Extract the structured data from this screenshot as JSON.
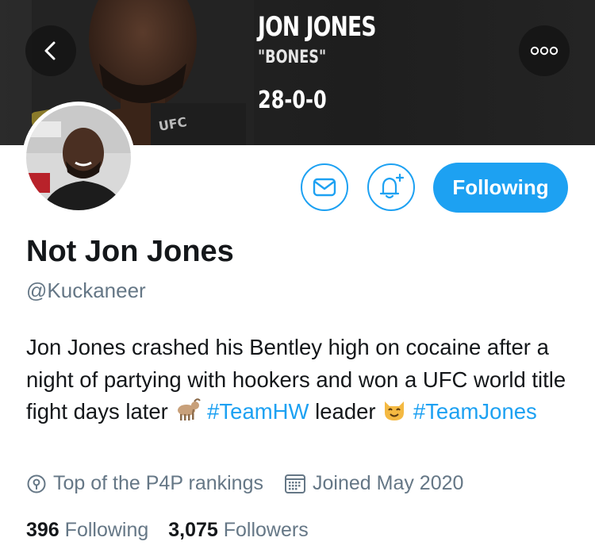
{
  "banner": {
    "fighter_name": "JON JONES",
    "nickname": "\"BONES\"",
    "record": "28-0-0"
  },
  "header": {
    "back_icon": "chevron-left-icon",
    "more_icon": "more-horizontal-icon"
  },
  "actions": {
    "message_icon": "envelope-icon",
    "notification_icon": "bell-plus-icon",
    "follow_label": "Following"
  },
  "profile": {
    "display_name": "Not Jon Jones",
    "handle": "@Kuckaneer",
    "bio": {
      "part1": "Jon Jones crashed his Bentley high on cocaine after a night of partying with hookers and won a UFC world title fight days later ",
      "hashtag1": "#TeamHW",
      "part2": " leader ",
      "hashtag2": "#TeamJones"
    },
    "location": "Top of the P4P rankings",
    "joined": "Joined May 2020"
  },
  "stats": {
    "following_count": "396",
    "following_label": "Following",
    "followers_count": "3,075",
    "followers_label": "Followers"
  },
  "colors": {
    "accent": "#1da1f2",
    "secondary_text": "#657786",
    "primary_text": "#14171a"
  }
}
